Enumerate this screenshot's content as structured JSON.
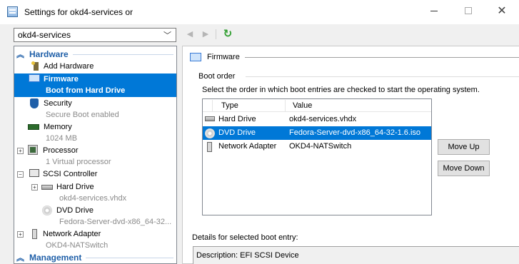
{
  "window": {
    "title": "Settings for okd4-services on",
    "minimize_glyph": "",
    "maximize_glyph": "",
    "close_glyph": "✕"
  },
  "toolbar": {
    "vm_selected": "okd4-services",
    "back_glyph": "◀",
    "forward_glyph": "▶",
    "refresh_glyph": "↻"
  },
  "tree": {
    "hardware_label": "Hardware",
    "management_label": "Management",
    "items": [
      {
        "label": "Add Hardware",
        "sub": ""
      },
      {
        "label": "Firmware",
        "sub": "Boot from Hard Drive"
      },
      {
        "label": "Security",
        "sub": "Secure Boot enabled"
      },
      {
        "label": "Memory",
        "sub": "1024 MB"
      },
      {
        "label": "Processor",
        "sub": "1 Virtual processor"
      },
      {
        "label": "SCSI Controller",
        "sub": ""
      },
      {
        "label": "Hard Drive",
        "sub": "okd4-services.vhdx"
      },
      {
        "label": "DVD Drive",
        "sub": "Fedora-Server-dvd-x86_64-32..."
      },
      {
        "label": "Network Adapter",
        "sub": "OKD4-NATSwitch"
      }
    ]
  },
  "panel": {
    "section_title": "Firmware",
    "boot_order_label": "Boot order",
    "instruction": "Select the order in which boot entries are checked to start the operating system.",
    "columns": [
      "Type",
      "Value"
    ],
    "rows": [
      {
        "type": "Hard Drive",
        "value": "okd4-services.vhdx"
      },
      {
        "type": "DVD Drive",
        "value": "Fedora-Server-dvd-x86_64-32-1.6.iso"
      },
      {
        "type": "Network Adapter",
        "value": "OKD4-NATSwitch"
      }
    ],
    "move_up_label": "Move Up",
    "move_down_label": "Move Down",
    "details_label": "Details for selected boot entry:",
    "details_value": "Description: EFI SCSI Device"
  },
  "colors": {
    "selection": "#0078d7",
    "category_text": "#1f5fa8",
    "refresh_green": "#2f9e2f"
  }
}
